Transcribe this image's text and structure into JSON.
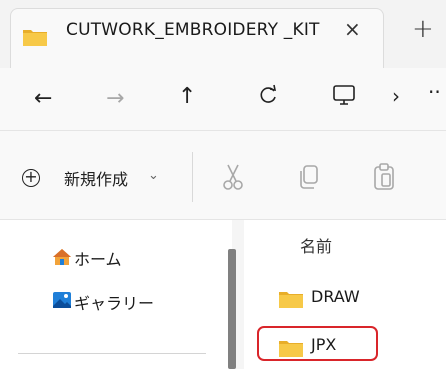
{
  "window": {
    "tab_title": "CUTWORK_EMBROIDERY _KIT",
    "tab_close": "×",
    "new_tab": "+"
  },
  "navbar": {
    "back": "←",
    "forward": "→",
    "up": "↑",
    "refresh": "C",
    "chevron": "›",
    "more": "··"
  },
  "commandbar": {
    "new_label": "新規作成",
    "new_plus": "+",
    "new_chevron": "⌄"
  },
  "sidebar": {
    "items": [
      {
        "label": "ホーム",
        "icon": "home-icon"
      },
      {
        "label": "ギャラリー",
        "icon": "gallery-icon"
      }
    ]
  },
  "content": {
    "column_header": "名前",
    "rows": [
      {
        "name": "DRAW",
        "icon": "folder-icon"
      },
      {
        "name": "JPX",
        "icon": "folder-icon",
        "highlighted": true
      }
    ]
  },
  "colors": {
    "folder": "#f5c342",
    "highlight": "#d9252a",
    "accent": "#0a64c8"
  }
}
